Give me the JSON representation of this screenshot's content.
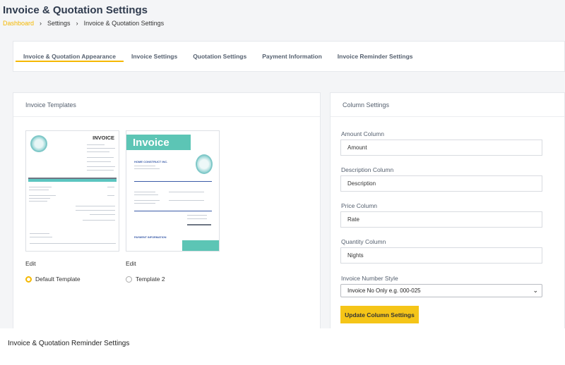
{
  "header": {
    "title": "Invoice & Quotation Settings",
    "breadcrumb": [
      {
        "label": "Dashboard"
      },
      {
        "label": "Settings"
      },
      {
        "label": "Invoice & Quotation Settings"
      }
    ]
  },
  "tabs": [
    {
      "label": "Invoice & Quotation Appearance",
      "active": true
    },
    {
      "label": "Invoice Settings",
      "active": false
    },
    {
      "label": "Quotation Settings",
      "active": false
    },
    {
      "label": "Payment Information",
      "active": false
    },
    {
      "label": "Invoice Reminder Settings",
      "active": false
    }
  ],
  "templates_card": {
    "title": "Invoice Templates",
    "templates": [
      {
        "edit_label": "Edit",
        "name": "Default Template",
        "selected": true,
        "thumb_title": "INVOICE"
      },
      {
        "edit_label": "Edit",
        "name": "Template 2",
        "selected": false,
        "thumb_title": "Invoice",
        "thumb_company": "HOME CONSTRUCT INC.",
        "thumb_payment": "PAYMENT INFORMATION"
      }
    ]
  },
  "column_settings": {
    "title": "Column Settings",
    "fields": {
      "amount": {
        "label": "Amount Column",
        "value": "Amount"
      },
      "description": {
        "label": "Description Column",
        "value": "Description"
      },
      "price": {
        "label": "Price Column",
        "value": "Rate"
      },
      "quantity": {
        "label": "Quantity Column",
        "value": "Nights"
      },
      "number_style": {
        "label": "Invoice Number Style",
        "value": "Invoice No Only e.g. 000-025"
      }
    },
    "update_button": "Update Column Settings"
  },
  "reminder_section": {
    "title": "Invoice & Quotation Reminder Settings"
  },
  "colors": {
    "accent": "#f5b800",
    "button": "#f5c518",
    "teal": "#5cc5b5",
    "blue": "#3a5ba8"
  }
}
